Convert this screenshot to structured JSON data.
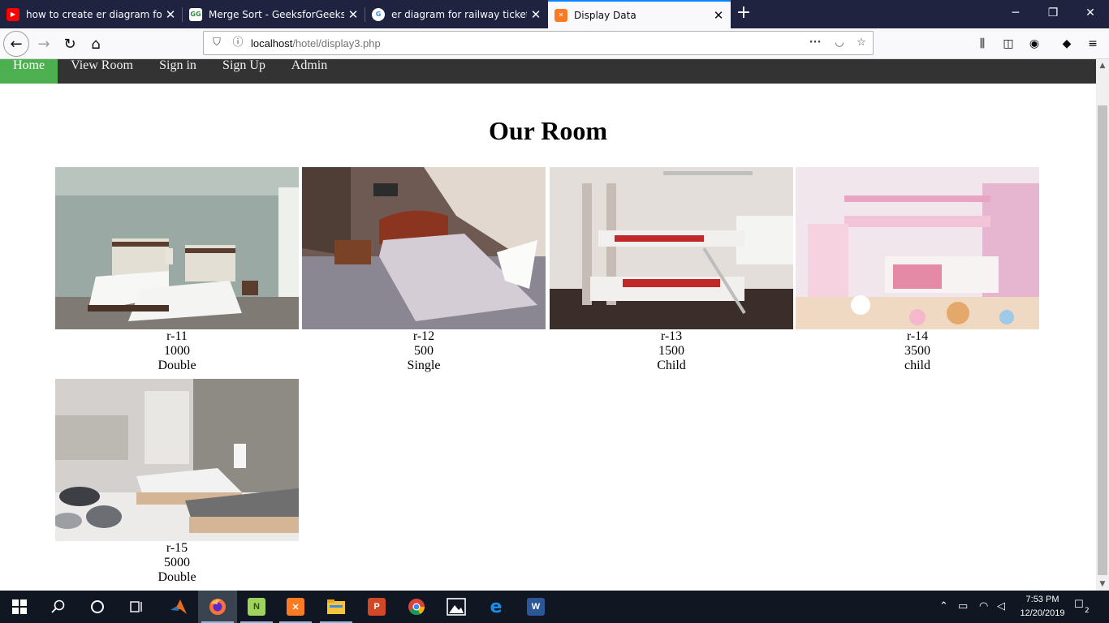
{
  "browser": {
    "tabs": [
      {
        "title": "how to create er diagram for tra",
        "icon": "youtube-icon",
        "active": false
      },
      {
        "title": "Merge Sort - GeeksforGeeks",
        "icon": "geeksforgeeks-icon",
        "active": false
      },
      {
        "title": "er diagram for railway ticket bo",
        "icon": "google-icon",
        "active": false
      },
      {
        "title": "Display Data",
        "icon": "xampp-icon",
        "active": true
      }
    ],
    "url_host": "localhost",
    "url_path": "/hotel/display3.php",
    "colors": {
      "tabbar": "#202340",
      "active_accent": "#0a84ff"
    }
  },
  "site_nav": {
    "items": [
      {
        "label": "Home",
        "active": true
      },
      {
        "label": "View Room",
        "active": false
      },
      {
        "label": "Sign in",
        "active": false
      },
      {
        "label": "Sign Up",
        "active": false
      },
      {
        "label": "Admin",
        "active": false
      }
    ],
    "colors": {
      "background": "#333333",
      "active": "#4caf50"
    }
  },
  "page": {
    "heading": "Our Room",
    "rooms": [
      {
        "id": "r-11",
        "price": "1000",
        "type": "Double",
        "photo": "twin-bed-room-photo"
      },
      {
        "id": "r-12",
        "price": "500",
        "type": "Single",
        "photo": "single-bed-room-photo"
      },
      {
        "id": "r-13",
        "price": "1500",
        "type": "Child",
        "photo": "bunk-bed-room-photo"
      },
      {
        "id": "r-14",
        "price": "3500",
        "type": "child",
        "photo": "pink-kids-room-photo"
      },
      {
        "id": "r-15",
        "price": "5000",
        "type": "Double",
        "photo": "rustic-twin-room-photo"
      }
    ]
  },
  "taskbar": {
    "apps": [
      "windows-start-icon",
      "search-icon",
      "cortana-icon",
      "task-view-icon",
      "matlab-icon",
      "firefox-icon",
      "notepad-plus-plus-icon",
      "xampp-icon",
      "file-explorer-icon",
      "powerpoint-icon",
      "chrome-icon",
      "photos-icon",
      "edge-icon",
      "word-icon"
    ],
    "time": "7:53 PM",
    "date": "12/20/2019",
    "notification_count": "2"
  }
}
